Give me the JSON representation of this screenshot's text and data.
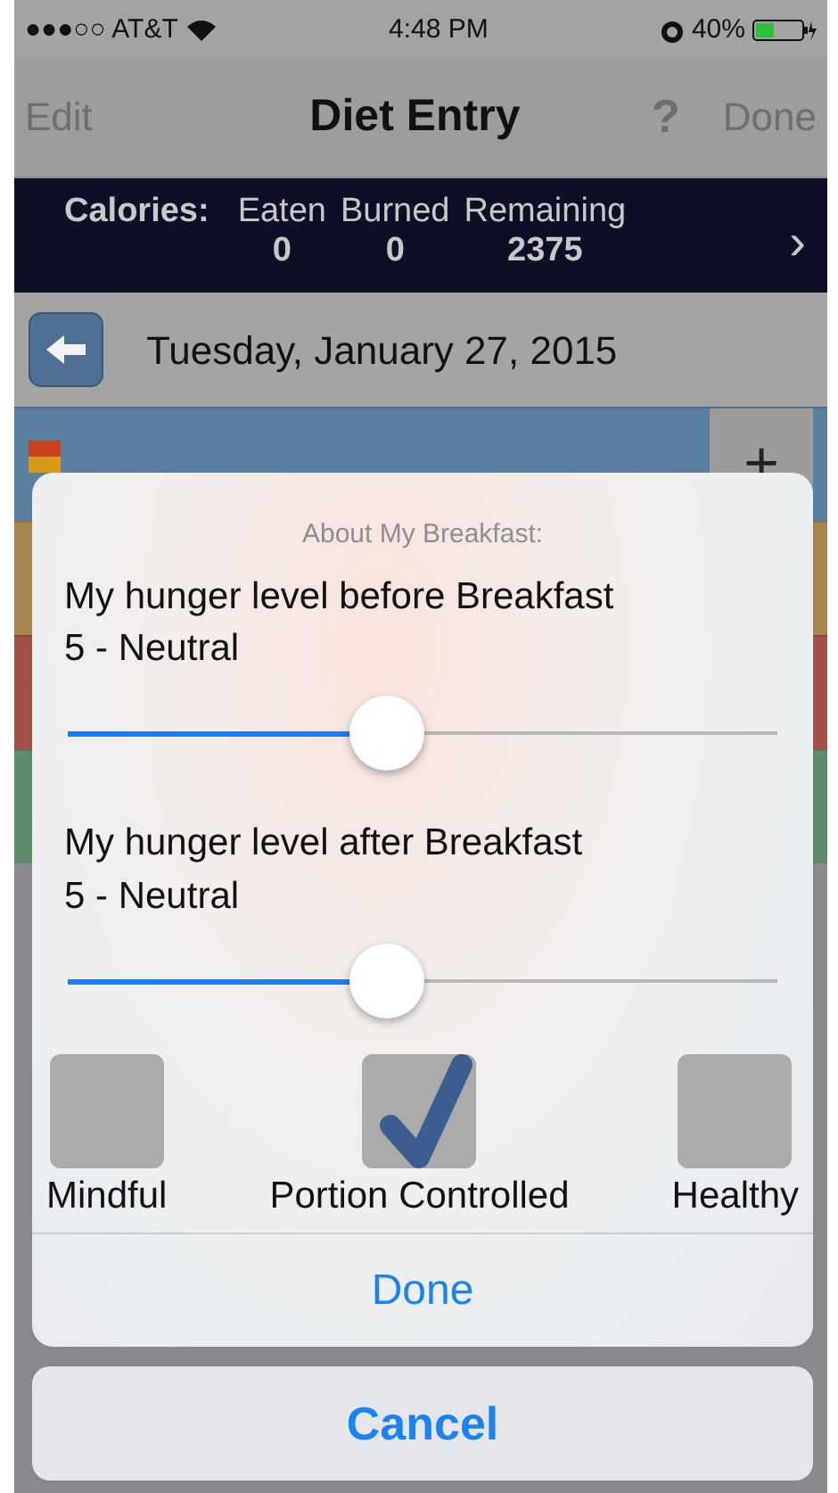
{
  "status_bar": {
    "carrier": "●●●○○ AT&T",
    "time": "4:48 PM",
    "battery": "40%"
  },
  "nav_bar": {
    "left": "Edit",
    "title": "Diet Entry",
    "help": "?",
    "right": "Done"
  },
  "calories": {
    "label": "Calories:",
    "columns": [
      {
        "heading": "Eaten",
        "value": "0"
      },
      {
        "heading": "Burned",
        "value": "0"
      },
      {
        "heading": "Remaining",
        "value": "2375"
      }
    ],
    "chevron": "›"
  },
  "date": "Tuesday, January 27, 2015",
  "meals": [
    {
      "add": "+",
      "color": "#5b7fa0"
    },
    {
      "color": "#a8854f"
    },
    {
      "color": "#a2504a"
    },
    {
      "color": "#5d8b6b"
    }
  ],
  "dialog": {
    "title": "About My Breakfast:",
    "sliders": [
      {
        "label": "My hunger level before Breakfast",
        "reading": "5 - Neutral",
        "level": 0.45
      },
      {
        "label": "My hunger level after Breakfast",
        "reading": "5 - Neutral",
        "level": 0.45
      }
    ],
    "options": [
      {
        "label": "Mindful",
        "checked": false
      },
      {
        "label": "Portion Controlled",
        "checked": true
      },
      {
        "label": "Healthy",
        "checked": false
      }
    ],
    "done": "Done"
  },
  "cancel": "Cancel"
}
